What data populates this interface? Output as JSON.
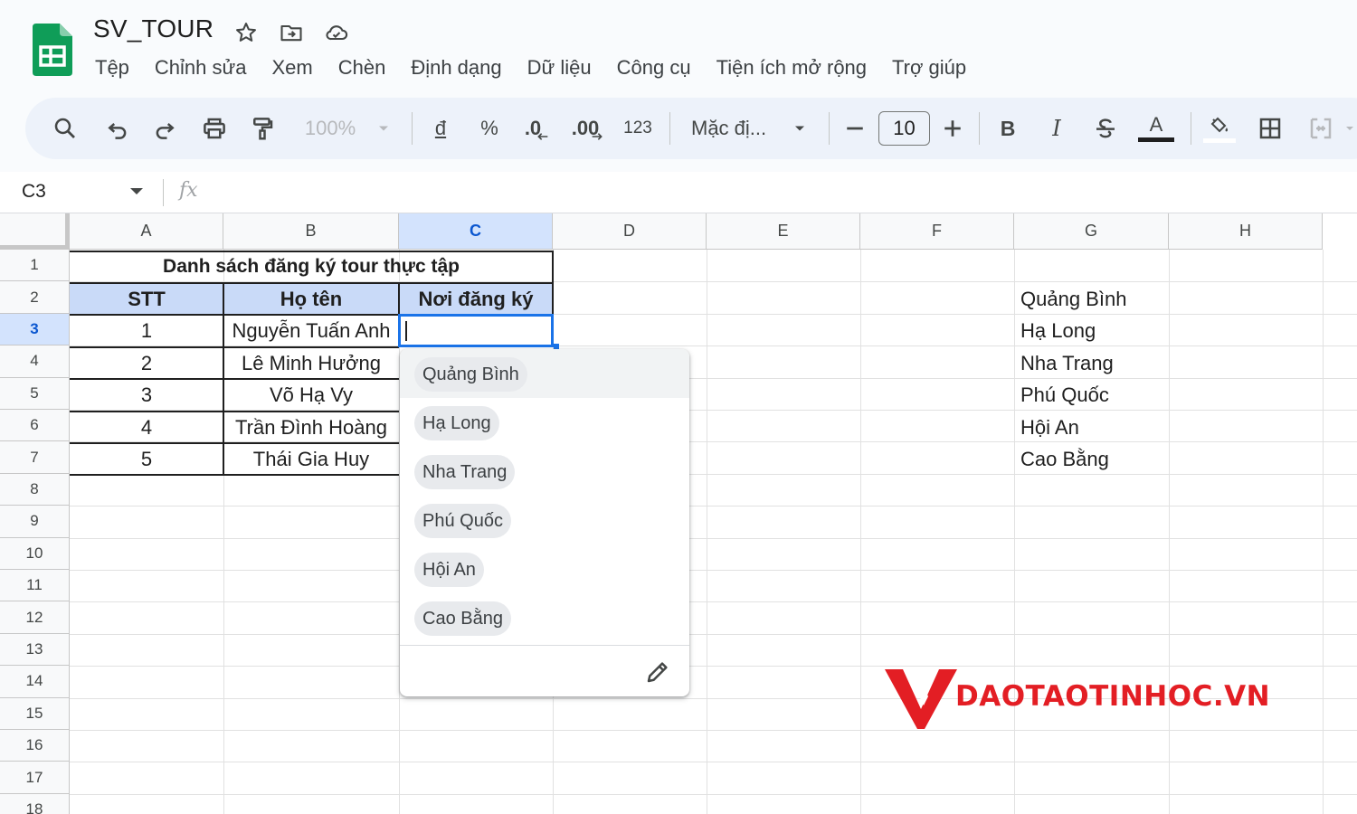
{
  "doc": {
    "title": "SV_TOUR",
    "menu": [
      "Tệp",
      "Chỉnh sửa",
      "Xem",
      "Chèn",
      "Định dạng",
      "Dữ liệu",
      "Công cụ",
      "Tiện ích mở rộng",
      "Trợ giúp"
    ]
  },
  "toolbar": {
    "zoom": "100%",
    "currency": "đ",
    "percent": "%",
    "decrease_decimal": ".0",
    "increase_decimal": ".00",
    "number_format": "123",
    "font": "Mặc đị...",
    "font_size": "10",
    "bold": "B",
    "italic": "I",
    "text_color_letter": "A"
  },
  "formula_bar": {
    "cell_ref": "C3",
    "fx": "fx"
  },
  "sheet": {
    "columns": [
      "A",
      "B",
      "C",
      "D",
      "E",
      "F",
      "G",
      "H"
    ],
    "selected_column": "C",
    "rows": [
      "1",
      "2",
      "3",
      "4",
      "5",
      "6",
      "7",
      "8",
      "9",
      "10",
      "11",
      "12",
      "13",
      "14",
      "15",
      "16",
      "17",
      "18"
    ],
    "selected_row": "3",
    "table_title": "Danh sách đăng ký tour thực tập",
    "table_headers": [
      "STT",
      "Họ tên",
      "Nơi đăng ký"
    ],
    "table_rows": [
      {
        "stt": "1",
        "name": "Nguyễn Tuấn Anh"
      },
      {
        "stt": "2",
        "name": "Lê Minh Hưởng"
      },
      {
        "stt": "3",
        "name": "Võ Hạ Vy"
      },
      {
        "stt": "4",
        "name": "Trần Đình Hoàng"
      },
      {
        "stt": "5",
        "name": "Thái Gia Huy"
      }
    ],
    "column_g": [
      "Quảng Bình",
      "Hạ Long",
      "Nha Trang",
      "Phú Quốc",
      "Hội An",
      "Cao Bằng"
    ]
  },
  "dropdown": {
    "options": [
      "Quảng Bình",
      "Hạ Long",
      "Nha Trang",
      "Phú Quốc",
      "Hội An",
      "Cao Bằng"
    ],
    "highlighted_index": 0
  },
  "watermark": {
    "text": "DAOTAOTINHOC.VN",
    "color": "#e31e24"
  },
  "colors": {
    "header_fill": "#c9daf8",
    "selection_blue": "#1a73e8",
    "sheets_green": "#0f9d58"
  }
}
